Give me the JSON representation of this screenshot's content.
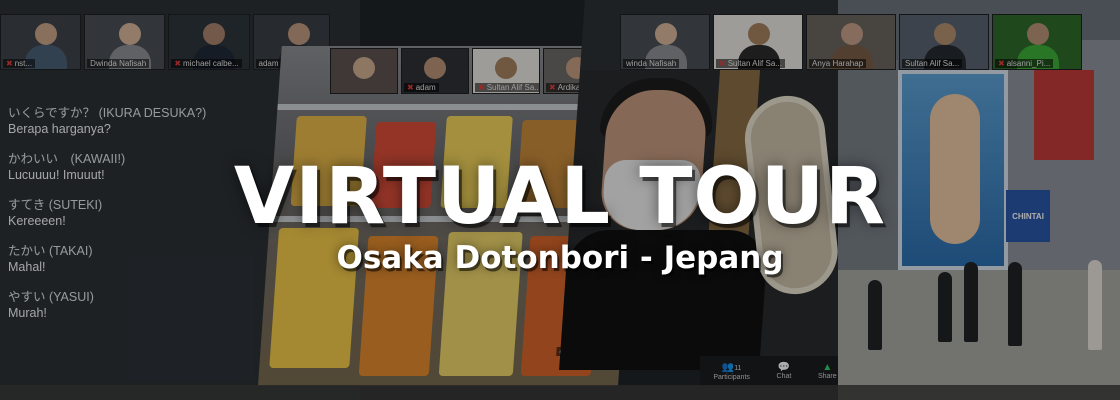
{
  "headline": {
    "title": "VIRTUAL TOUR",
    "subtitle": "Osaka Dotonbori - Jepang"
  },
  "gallery_left": [
    {
      "name": "nst..."
    },
    {
      "name": "Dwinda Nafisah"
    },
    {
      "name": "michael calbe..."
    },
    {
      "name": "adam"
    }
  ],
  "gallery_center": [
    {
      "name": ""
    },
    {
      "name": "adam"
    },
    {
      "name": "Sultan Alif Sa..."
    },
    {
      "name": "Ardika family"
    }
  ],
  "gallery_right": [
    {
      "name": "winda Nafisah"
    },
    {
      "name": "Sultan Alif Sa..."
    },
    {
      "name": "Anya Harahap"
    },
    {
      "name": "Sultan Alif Sa..."
    },
    {
      "name": "alsanni_Pi..."
    }
  ],
  "slide": {
    "phrases": [
      {
        "jp": "いくらですか？ (IKURA DESUKA?)",
        "id": "Berapa harganya?"
      },
      {
        "jp": "かわいい　(KAWAII!)",
        "id": "Lucuuuu! Imuuut!"
      },
      {
        "jp": "すてき (SUTEKI)",
        "id": "Kereeeen!"
      },
      {
        "jp": "たかい (TAKAI)",
        "id": "Mahal!"
      },
      {
        "jp": "やすい (YASUI)",
        "id": "Murah!"
      }
    ]
  },
  "zoom_controls": {
    "participants_label": "Participants",
    "participants_count": "11",
    "chat_label": "Chat",
    "share_label": "Share"
  },
  "speaker_tag": "calbera",
  "signs": {
    "blue_sign": "CHINTAI"
  },
  "colors": {
    "glico_blue": "#2c6fb0",
    "sign_red": "#c23a3a",
    "mic_muted": "#e03b3b"
  }
}
